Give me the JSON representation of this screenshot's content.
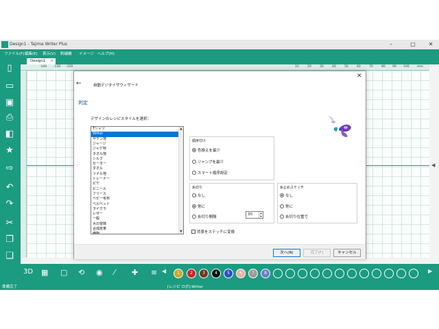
{
  "app": {
    "title": "Design1 - Tajima Writer Plus",
    "doc_tab": "Design1",
    "tab_close": "×",
    "window_buttons": [
      "–",
      "□",
      "✕"
    ]
  },
  "menu": [
    "ファイル(F)",
    "編集(E)",
    "表示(V)",
    "刺繍機",
    "イメージ",
    "ヘルプ(H)"
  ],
  "ruler_labels": [
    "-140",
    "-130",
    "-120",
    "10",
    "20",
    "30",
    "40",
    "50",
    "60",
    "70",
    "80",
    "90",
    "100",
    "110",
    "120",
    "130",
    "140",
    "mm"
  ],
  "bottom_tool_labels": {
    "three_d": "3D"
  },
  "colors": {
    "accent": "#1b9b80",
    "swatches": [
      {
        "num": "1",
        "color": "#c8a82a"
      },
      {
        "num": "2",
        "color": "#c8262a"
      },
      {
        "num": "3",
        "color": "#6b3a1e"
      },
      {
        "num": "4",
        "color": "#111111"
      },
      {
        "num": "5",
        "color": "#2a4fc8"
      },
      {
        "num": "6",
        "color": "#e8b0a0"
      },
      {
        "num": "7",
        "color": "#9a9a9a"
      },
      {
        "num": "8",
        "color": "#6a80c8"
      }
    ]
  },
  "status": {
    "left": "準備完了",
    "center": "[レジピ ロボ]:Writer"
  },
  "dialog": {
    "back_icon": "←",
    "title": "自動デジタイザウィザード",
    "close_icon": "✕",
    "heading": "判定",
    "prompt": "デザインのレシピスタイルを選択：",
    "styles": [
      "Tシャツ",
      "Writer",
      "サテン地",
      "ジャージ",
      "ジャケ地",
      "タオル地",
      "シルク",
      "セーター",
      "タオル",
      "ツイル地",
      "トレーナー",
      "ピケ",
      "ビニール",
      "フリース",
      "ベビー毛布",
      "ベルベット",
      "ライクラ",
      "レザー",
      "一般",
      "大の冒険",
      "合成皮革",
      "織物"
    ],
    "selected_style": "Writer",
    "order_group": {
      "title": "順序付け",
      "options": [
        "色換えを最少",
        "ジャンプを最少",
        "スマート順序設定"
      ],
      "selected": "色換えを最少"
    },
    "trim_group": {
      "title": "糸切り",
      "options": [
        "なし",
        "常に",
        "糸切り間隔"
      ],
      "selected": "常に",
      "interval": "30"
    },
    "tieoff_group": {
      "title": "糸止めステッチ",
      "options": [
        "なし",
        "常に",
        "糸切り位置で"
      ],
      "selected": "なし"
    },
    "checkbox_label": "背景をステッチに変換",
    "buttons": {
      "next": "次へ(N)",
      "finish": "完了(F)",
      "cancel": "キャンセル"
    }
  }
}
